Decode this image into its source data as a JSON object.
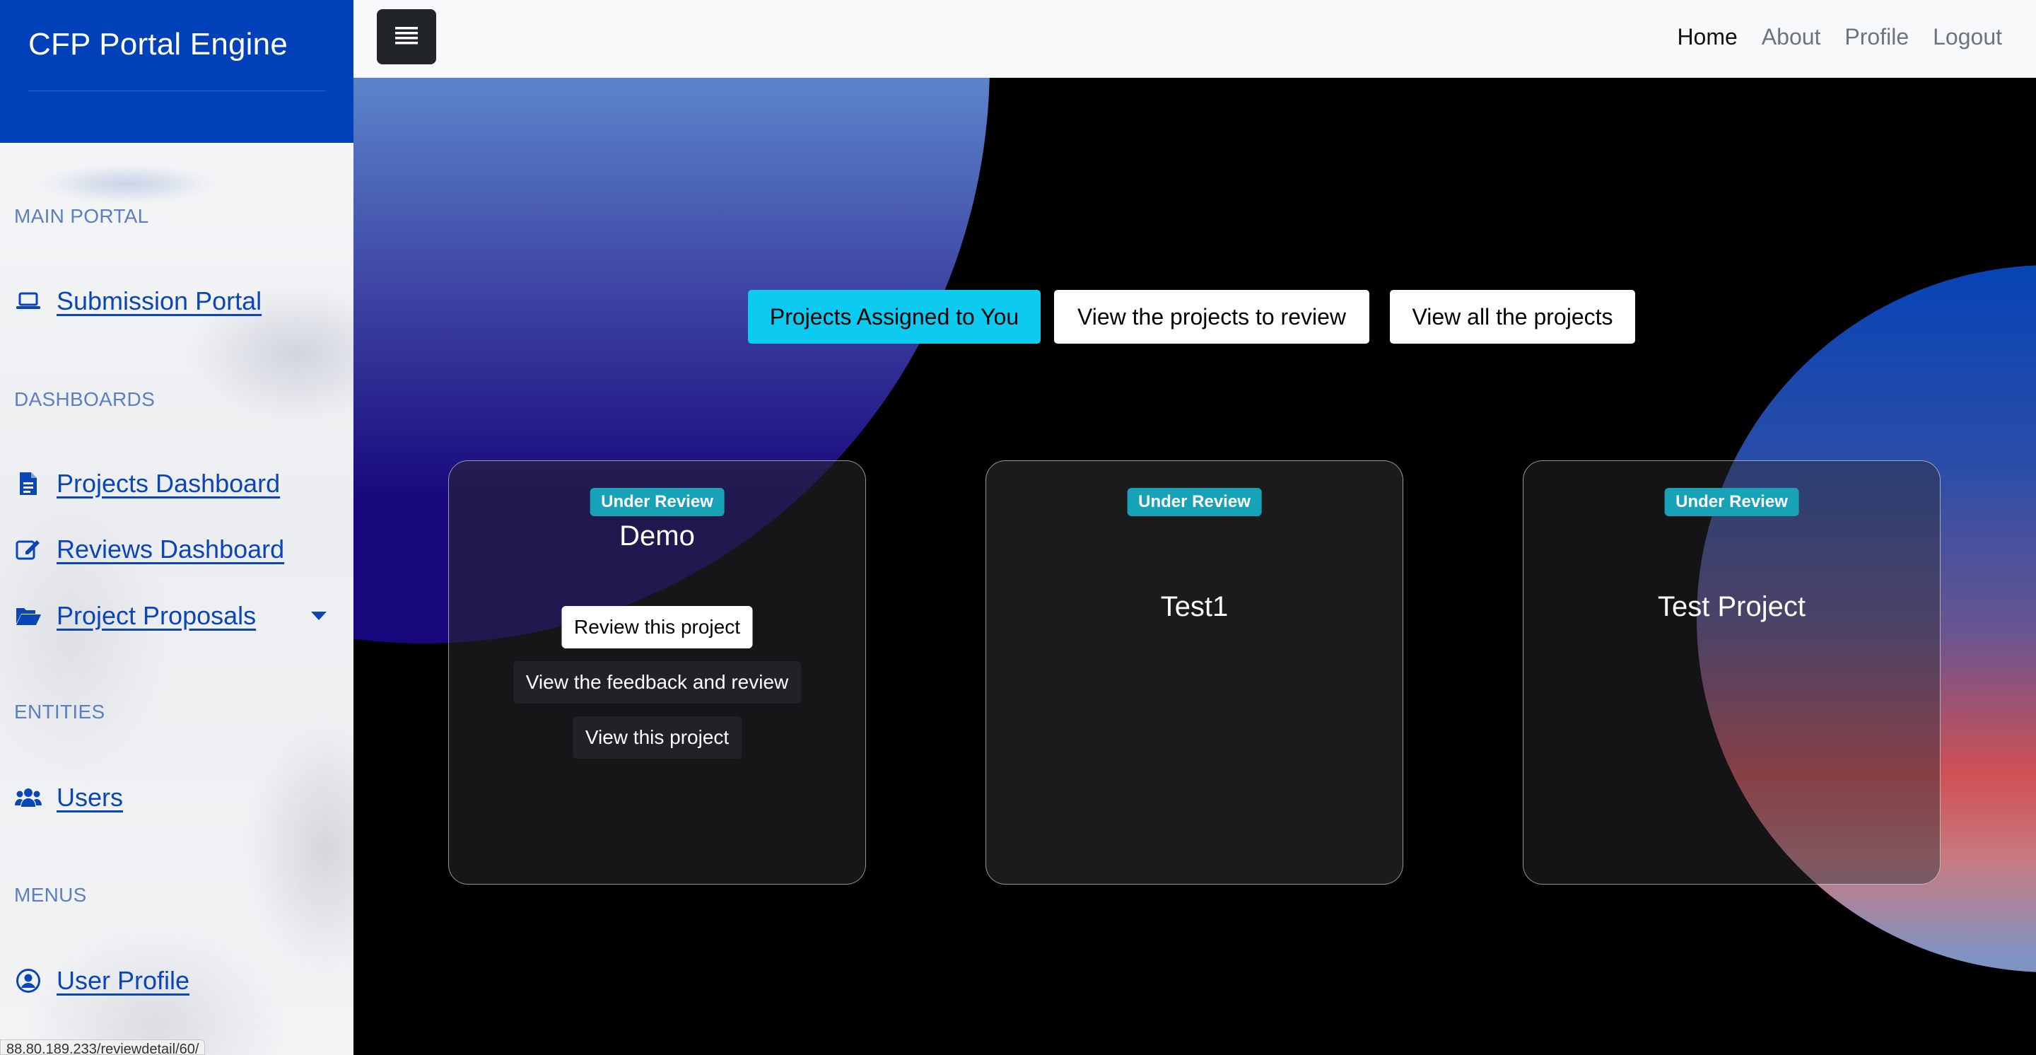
{
  "sidebar": {
    "brand": "CFP Portal Engine",
    "sections": {
      "main_portal": "MAIN PORTAL",
      "dashboards": "DASHBOARDS",
      "entities": "ENTITIES",
      "menus": "MENUS"
    },
    "items": {
      "submission_portal": {
        "label": "Submission Portal",
        "icon": "laptop-icon"
      },
      "projects_dashboard": {
        "label": "Projects Dashboard",
        "icon": "file-text-icon"
      },
      "reviews_dashboard": {
        "label": "Reviews Dashboard",
        "icon": "edit-icon"
      },
      "project_proposals": {
        "label": "Project Proposals",
        "icon": "folder-open-icon"
      },
      "users": {
        "label": "Users",
        "icon": "users-icon"
      },
      "user_profile": {
        "label": "User Profile",
        "icon": "user-circle-icon"
      }
    },
    "status_url": "88.80.189.233/reviewdetail/60/"
  },
  "navbar": {
    "links": [
      "Home",
      "About",
      "Profile",
      "Logout"
    ],
    "active": "Home"
  },
  "tabs": {
    "assigned": "Projects Assigned to You",
    "to_review": "View the projects to review",
    "all": "View all the projects"
  },
  "cards": [
    {
      "status": "Under Review",
      "title": "Demo",
      "actions": [
        "Review this project",
        "View the feedback and review",
        "View this project"
      ]
    },
    {
      "status": "Under Review",
      "title": "Test1"
    },
    {
      "status": "Under Review",
      "title": "Test Project"
    }
  ],
  "colors": {
    "brand_blue": "#0041b9",
    "link_blue": "#0b46b6",
    "accent_cyan": "#0dcaf0",
    "badge_teal": "#17a2b8"
  }
}
